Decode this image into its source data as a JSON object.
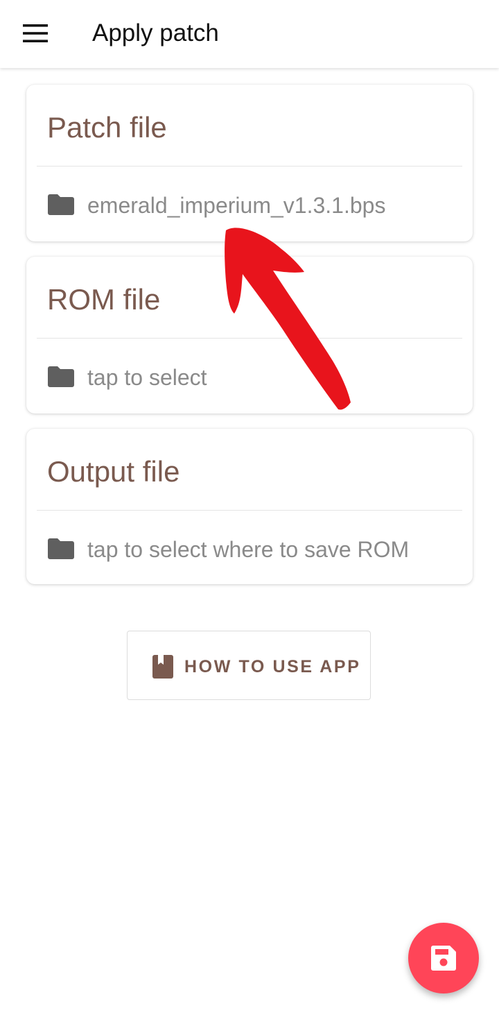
{
  "appbar": {
    "title": "Apply patch",
    "menu_icon": "hamburger-menu-icon"
  },
  "cards": [
    {
      "title": "Patch file",
      "value": "emerald_imperium_v1.3.1.bps",
      "icon": "folder-icon"
    },
    {
      "title": "ROM file",
      "value": "tap to select",
      "icon": "folder-icon"
    },
    {
      "title": "Output file",
      "value": "tap to select where to save ROM",
      "icon": "folder-icon"
    }
  ],
  "help_button": {
    "label": "HOW TO USE APP",
    "icon": "book-icon"
  },
  "fab": {
    "icon": "save-icon"
  },
  "annotation": {
    "icon": "red-arrow",
    "color": "#e8141c"
  },
  "colors": {
    "accent": "#7a5a4f",
    "fab": "#ff4558",
    "muted_text": "#8a8a8a",
    "icon_gray": "#5f5f5f"
  }
}
